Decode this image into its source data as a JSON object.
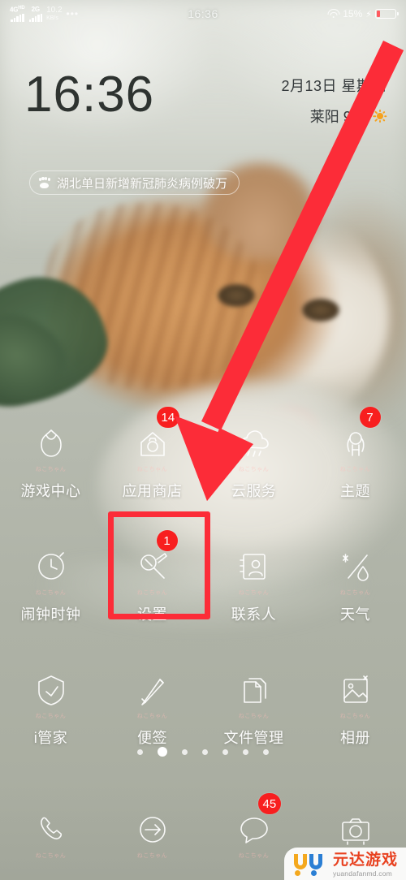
{
  "statusbar": {
    "network1_label": "4G",
    "network1_sup": "HD",
    "network2_label": "2G",
    "speed_value": "10.2",
    "speed_unit": "KB/s",
    "overflow": "•••",
    "time": "16:36",
    "battery_percent": "15%",
    "wifi_icon": "wifi-icon",
    "charging_icon": "charging-bolt-icon",
    "battery_fill_pct": 15,
    "battery_color": "#ff5a5f"
  },
  "widget": {
    "clock": "16:36",
    "date": "2月13日 星期四",
    "weather": "莱阳 9℃",
    "weather_icon": "sun-icon",
    "weather_icon_color": "#f6a21e"
  },
  "news_banner": {
    "icon": "paw-print-icon",
    "text": "湖北单日新增新冠肺炎病例破万"
  },
  "apps": {
    "sublabel": "ねこちゃん",
    "rows": [
      [
        {
          "label": "游戏中心",
          "icon": "game-center-icon",
          "badge": null
        },
        {
          "label": "应用商店",
          "icon": "app-store-icon",
          "badge": "14"
        },
        {
          "label": "云服务",
          "icon": "cloud-service-icon",
          "badge": null
        },
        {
          "label": "主题",
          "icon": "theme-icon",
          "badge": "7"
        }
      ],
      [
        {
          "label": "闹钟时钟",
          "icon": "clock-icon",
          "badge": null
        },
        {
          "label": "设置",
          "icon": "settings-wrench-icon",
          "badge": "1"
        },
        {
          "label": "联系人",
          "icon": "contacts-icon",
          "badge": null
        },
        {
          "label": "天气",
          "icon": "weather-icon",
          "badge": null
        }
      ],
      [
        {
          "label": "i管家",
          "icon": "shield-manager-icon",
          "badge": null
        },
        {
          "label": "便签",
          "icon": "notes-pencil-icon",
          "badge": null
        },
        {
          "label": "文件管理",
          "icon": "file-manager-icon",
          "badge": null
        },
        {
          "label": "相册",
          "icon": "gallery-icon",
          "badge": null
        }
      ]
    ]
  },
  "page_indicator": {
    "count": 7,
    "active_index": 1
  },
  "dock": [
    {
      "label": "",
      "icon": "phone-icon",
      "badge": null
    },
    {
      "label": "",
      "icon": "browser-arrow-icon",
      "badge": null
    },
    {
      "label": "",
      "icon": "message-bubble-icon",
      "badge": "45"
    },
    {
      "label": "",
      "icon": "camera-icon",
      "badge": null
    }
  ],
  "annotations": {
    "arrow_color": "#fc2c38",
    "highlight_box_color": "#fc2c38",
    "arrow_target": "settings-app",
    "highlight_target": "settings-app"
  },
  "watermark": {
    "cn": "元达游戏",
    "en": "yuandafanmd.com",
    "logo": "yu-logo-icon"
  }
}
